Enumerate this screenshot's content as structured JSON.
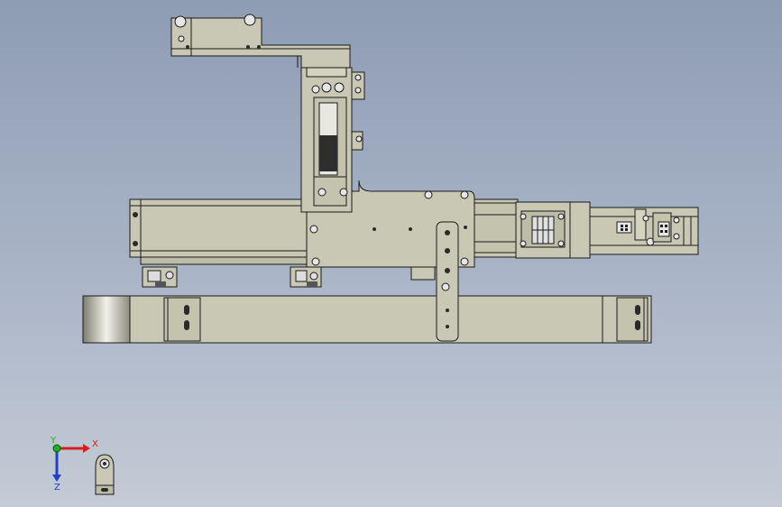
{
  "viewport": {
    "background_top": "#8e9cb4",
    "background_bottom": "#c4cbd6",
    "part_fill": "#c9c8b4",
    "part_fill_light": "#d4d3c0",
    "part_fill_dark": "#b4b39e",
    "edge_color": "#1a1a1a",
    "hole_color": "#2a2a2a"
  },
  "triad": {
    "x_label": "X",
    "y_label": "Y",
    "z_label": "Z",
    "x_color": "#d42020",
    "y_color": "#20b020",
    "z_color": "#2040c8"
  }
}
